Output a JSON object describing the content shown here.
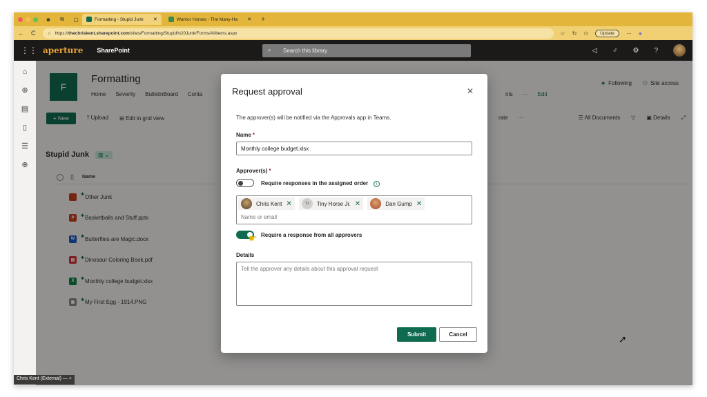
{
  "browser": {
    "tabs": [
      {
        "label": "Formatting - Stupid Junk",
        "active": true
      },
      {
        "label": "Warrior Horses - The Many-Ha",
        "active": false
      }
    ],
    "url_prefix": "https://",
    "url_host": "thechriskent.sharepoint.com",
    "url_path": "/sites/Formatting/Stupid%20Junk/Forms/AllItems.aspx",
    "update_label": "Update"
  },
  "suite": {
    "logo": "aperture",
    "app_name": "SharePoint",
    "search_placeholder": "Search this library"
  },
  "site": {
    "logo_letter": "F",
    "title": "Formatting",
    "nav": [
      "Home",
      "Severity",
      "BulletinBoard",
      "Conta"
    ],
    "nav_right": [
      "nts",
      "···",
      "Edit"
    ],
    "following_label": "Following",
    "site_access_label": "Site access"
  },
  "commands": {
    "new_label": "+ New",
    "upload_label": "Upload",
    "grid_label": "Edit in grid view",
    "automate_label": "rate",
    "more_label": "···",
    "view_label": "All Documents",
    "details_label": "Details"
  },
  "library": {
    "title": "Stupid Junk",
    "column_name": "Name",
    "files": [
      {
        "name": "Other Junk",
        "type": "folder",
        "color": "#c43e1c"
      },
      {
        "name": "Basketballs and Stuff.pptx",
        "type": "pptx",
        "color": "#c43e1c"
      },
      {
        "name": "Butterflies are Magic.docx",
        "type": "docx",
        "color": "#185abd"
      },
      {
        "name": "Dinosaur Coloring Book.pdf",
        "type": "pdf",
        "color": "#d13438"
      },
      {
        "name": "Monthly college budget.xlsx",
        "type": "xlsx",
        "color": "#107c41"
      },
      {
        "name": "My First Egg - 1914.PNG",
        "type": "png",
        "color": "#8a8886"
      }
    ]
  },
  "dialog": {
    "title": "Request approval",
    "description": "The approver(s) will be notified via the Approvals app in Teams.",
    "name_label": "Name",
    "name_value": "Monthly college budget.xlsx",
    "approvers_label": "Approver(s)",
    "order_toggle_label": "Require responses in the assigned order",
    "order_toggle_on": false,
    "approvers": [
      {
        "name": "Chris Kent",
        "initials": ""
      },
      {
        "name": "Tiny Horse Jr.",
        "initials": "TJ"
      },
      {
        "name": "Dan Gump",
        "initials": ""
      }
    ],
    "approver_placeholder": "Name or email",
    "all_toggle_label": "Require a response from all approvers",
    "all_toggle_on": true,
    "details_label": "Details",
    "details_placeholder": "Tell the approver any details about this approval request",
    "submit_label": "Submit",
    "cancel_label": "Cancel"
  },
  "footer_chip": "Chris Kent (External) — +",
  "colors": {
    "brand": "#0f6b4f",
    "tabbar": "#e3b63b",
    "suite": "#1b1a19"
  }
}
